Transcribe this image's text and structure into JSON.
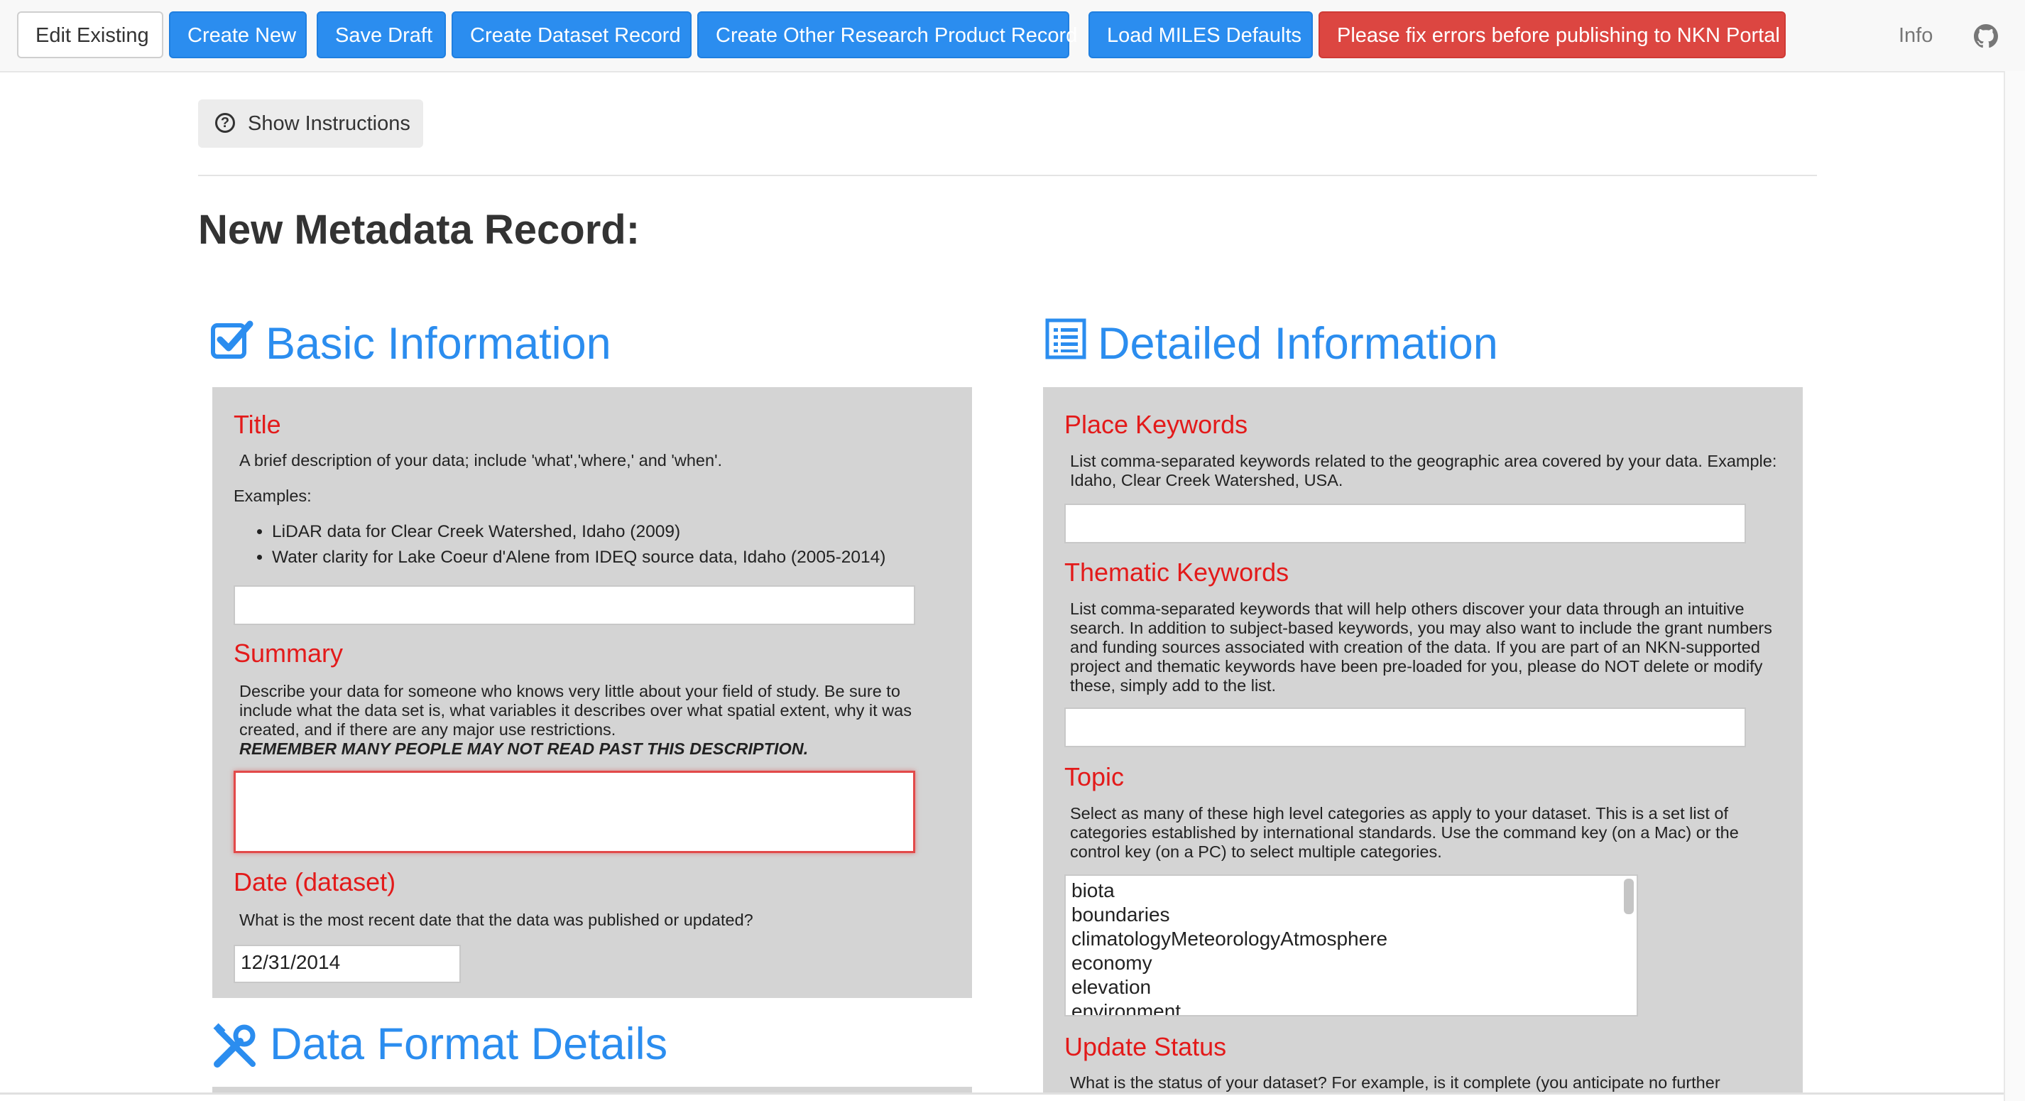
{
  "nav": {
    "edit_existing": "Edit Existing",
    "create_new": "Create New",
    "save_draft": "Save Draft",
    "create_dataset": "Create Dataset Record",
    "create_other": "Create Other Research Product Record",
    "load_defaults": "Load MILES Defaults",
    "publish_error": "Please fix errors before publishing to NKN Portal",
    "info": "Info",
    "github_icon": "github-icon"
  },
  "instructions_button": "Show Instructions",
  "page_title": "New Metadata Record:",
  "basic": {
    "heading": "Basic Information",
    "title": {
      "label": "Title",
      "help": "A brief description of your data; include 'what','where,' and 'when'.",
      "examples_label": "Examples:",
      "examples": [
        "LiDAR data for Clear Creek Watershed, Idaho (2009)",
        "Water clarity for Lake Coeur d'Alene from IDEQ source data, Idaho (2005-2014)"
      ],
      "value": ""
    },
    "summary": {
      "label": "Summary",
      "help": "Describe your data for someone who knows very little about your field of study. Be sure to include what the data set is, what variables it describes over what spatial extent, why it was created, and if there are any major use restrictions.",
      "warning": "REMEMBER MANY PEOPLE MAY NOT READ PAST THIS DESCRIPTION.",
      "value": ""
    },
    "date": {
      "label": "Date (dataset)",
      "help": "What is the most recent date that the data was published or updated?",
      "value": "12/31/2014"
    }
  },
  "format": {
    "heading": "Data Format Details"
  },
  "detailed": {
    "heading": "Detailed Information",
    "place": {
      "label": "Place Keywords",
      "help": "List comma-separated keywords related to the geographic area covered by your data. Example: Idaho, Clear Creek Watershed, USA.",
      "value": ""
    },
    "thematic": {
      "label": "Thematic Keywords",
      "help": "List comma-separated keywords that will help others discover your data through an intuitive search. In addition to subject-based keywords, you may also want to include the grant numbers and funding sources associated with creation of the data. If you are part of an NKN-supported project and thematic keywords have been pre-loaded for you, please do NOT delete or modify these, simply add to the list.",
      "value": ""
    },
    "topic": {
      "label": "Topic",
      "help": "Select as many of these high level categories as apply to your dataset. This is a set list of categories established by international standards. Use the command key (on a Mac) or the control key (on a PC) to select multiple categories.",
      "options": [
        "biota",
        "boundaries",
        "climatologyMeteorologyAtmosphere",
        "economy",
        "elevation",
        "environment"
      ]
    },
    "status": {
      "label": "Update Status",
      "help": "What is the status of your dataset? For example, is it complete (you anticipate no further"
    }
  }
}
